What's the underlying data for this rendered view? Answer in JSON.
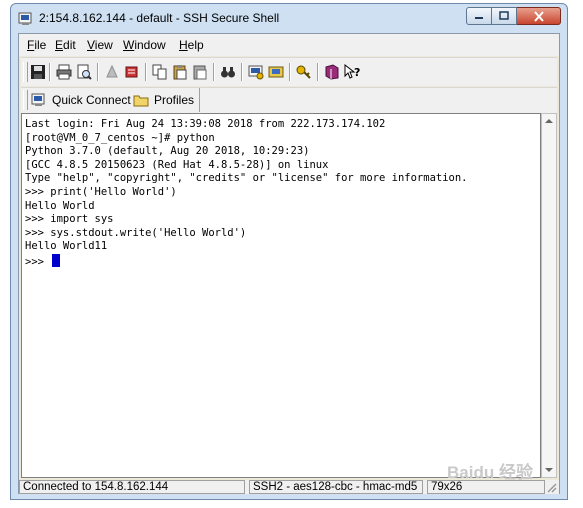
{
  "window": {
    "title": "2:154.8.162.144 - default - SSH Secure Shell"
  },
  "menu": [
    {
      "label": "File",
      "accel": "F",
      "rest": "ile"
    },
    {
      "label": "Edit",
      "accel": "E",
      "rest": "dit"
    },
    {
      "label": "View",
      "accel": "V",
      "rest": "iew"
    },
    {
      "label": "Window",
      "accel": "W",
      "rest": "indow"
    },
    {
      "label": "Help",
      "accel": "H",
      "rest": "elp"
    }
  ],
  "toolbar": {
    "icons": [
      "save-icon",
      "print-icon",
      "print-preview-icon",
      "disabled-a-icon",
      "disabled-b-icon",
      "copy-icon",
      "paste-icon",
      "paste-alt-icon",
      "find-icon",
      "settings-icon",
      "file-transfer-icon",
      "keygen-icon",
      "help-book-icon",
      "context-help-icon"
    ]
  },
  "profilebar": {
    "quick_connect": "Quick Connect",
    "profiles": "Profiles"
  },
  "terminal": {
    "lines": [
      "Last login: Fri Aug 24 13:39:08 2018 from 222.173.174.102",
      "[root@VM_0_7_centos ~]# python",
      "Python 3.7.0 (default, Aug 20 2018, 10:29:23)",
      "[GCC 4.8.5 20150623 (Red Hat 4.8.5-28)] on linux",
      "Type \"help\", \"copyright\", \"credits\" or \"license\" for more information.",
      ">>> print('Hello World')",
      "Hello World",
      ">>> import sys",
      ">>> sys.stdout.write('Hello World')",
      "Hello World11"
    ],
    "prompt": ">>> "
  },
  "status": {
    "connection": "Connected to 154.8.162.144",
    "cipher": "SSH2 - aes128-cbc - hmac-md5",
    "size": "79x26"
  },
  "watermark": "Baidu 经验"
}
